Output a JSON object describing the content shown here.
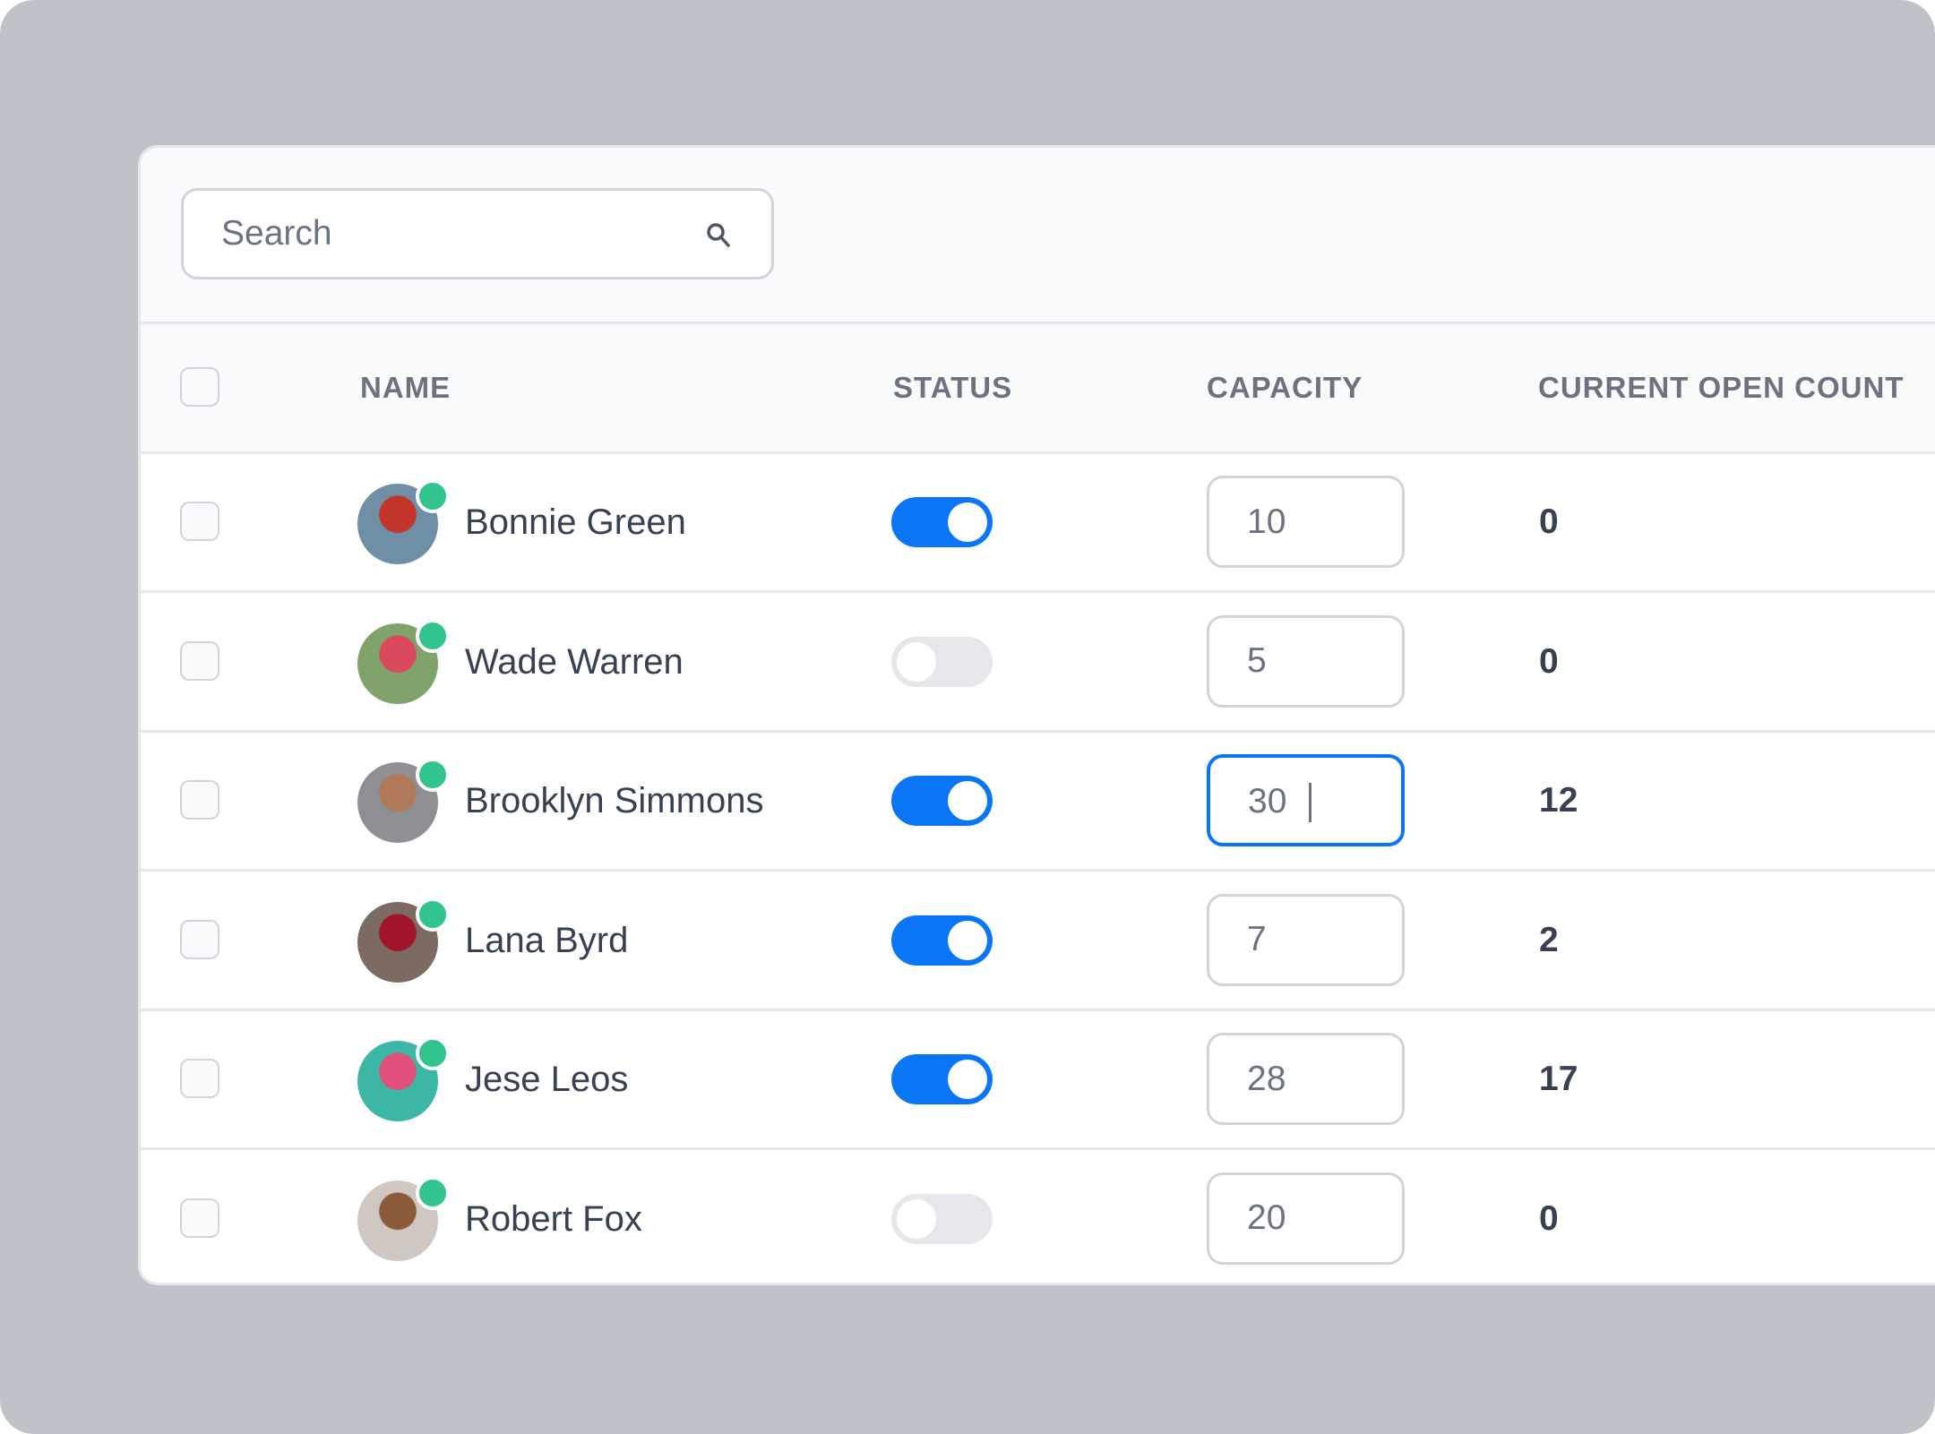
{
  "search": {
    "placeholder": "Search",
    "value": "",
    "icon": "search-icon"
  },
  "table": {
    "headers": {
      "name": "NAME",
      "status": "STATUS",
      "capacity": "CAPACITY",
      "count": "CURRENT OPEN COUNT"
    },
    "rows": [
      {
        "name": "Bonnie Green",
        "online": true,
        "status_on": true,
        "capacity": "10",
        "count": "0",
        "avatar_colors": [
          "#6E8FA6",
          "#C3352B"
        ]
      },
      {
        "name": "Wade Warren",
        "online": true,
        "status_on": false,
        "capacity": "5",
        "count": "0",
        "avatar_colors": [
          "#7FA36B",
          "#D94A5C"
        ]
      },
      {
        "name": "Brooklyn Simmons",
        "online": true,
        "status_on": true,
        "capacity": "30",
        "count": "12",
        "focused": true,
        "avatar_colors": [
          "#8D8F93",
          "#B07A5A"
        ]
      },
      {
        "name": "Lana Byrd",
        "online": true,
        "status_on": true,
        "capacity": "7",
        "count": "2",
        "avatar_colors": [
          "#7B6B63",
          "#A0152A"
        ]
      },
      {
        "name": "Jese Leos",
        "online": true,
        "status_on": true,
        "capacity": "28",
        "count": "17",
        "avatar_colors": [
          "#3CB7A6",
          "#E0507A"
        ]
      },
      {
        "name": "Robert Fox",
        "online": true,
        "status_on": false,
        "capacity": "20",
        "count": "0",
        "avatar_colors": [
          "#CFC8C2",
          "#8A5A3A"
        ]
      }
    ]
  },
  "colors": {
    "accent": "#0A76F6",
    "online": "#31C48D",
    "toggle_off": "#E5E7EB",
    "frame": "#BFC2C9"
  }
}
